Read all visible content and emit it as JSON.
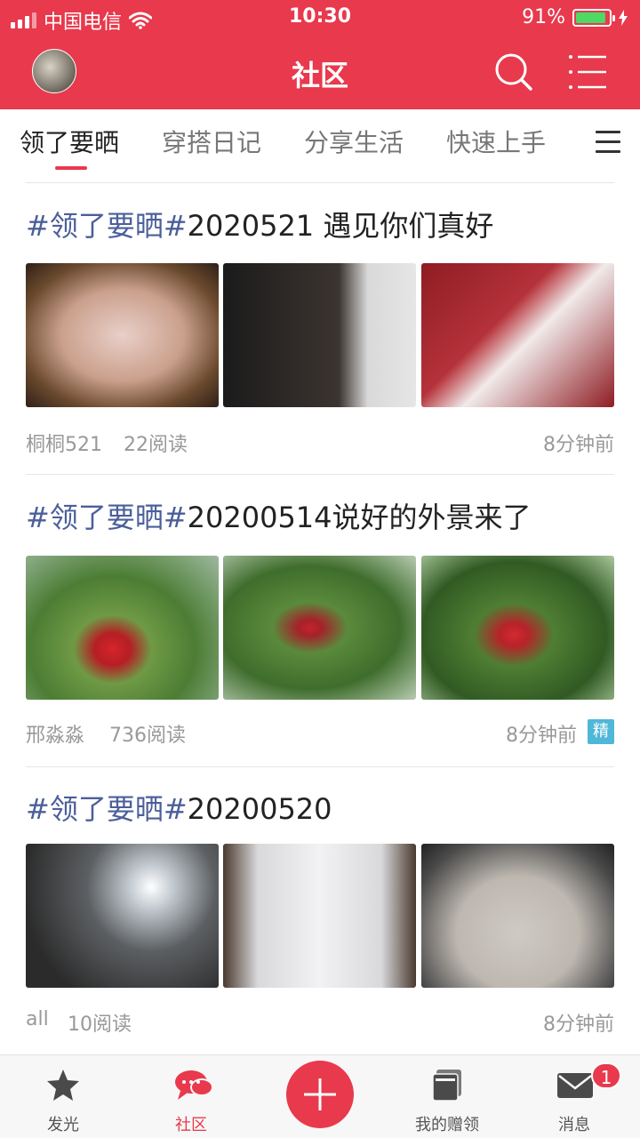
{
  "status_bar": {
    "carrier": "中国电信",
    "time": "10:30",
    "battery": "91%",
    "battery_level": 0.91
  },
  "header": {
    "title": "社区"
  },
  "tabs": [
    {
      "label": "领了要晒",
      "active": true
    },
    {
      "label": "穿搭日记",
      "active": false
    },
    {
      "label": "分享生活",
      "active": false
    },
    {
      "label": "快速上手",
      "active": false
    }
  ],
  "posts": [
    {
      "tag": "#领了要晒#",
      "title": "2020521 遇见你们真好",
      "author": "桐桐521",
      "reads": "22阅读",
      "time": "8分钟前"
    },
    {
      "tag": "#领了要晒#",
      "title": "20200514说好的外景来了",
      "author": "邢淼淼",
      "reads": "736阅读",
      "time": "8分钟前",
      "badge": "精"
    },
    {
      "tag": "#领了要晒#",
      "title": "20200520",
      "author": "all",
      "reads": "10阅读",
      "time": "8分钟前"
    }
  ],
  "bottom_nav": [
    {
      "label": "发光",
      "icon": "star-icon",
      "active": false
    },
    {
      "label": "社区",
      "icon": "chat-bubble-icon",
      "active": true
    },
    {
      "label": "我的赠领",
      "icon": "stack-icon",
      "active": false
    },
    {
      "label": "消息",
      "icon": "envelope-icon",
      "active": false
    }
  ],
  "notification_count": "1",
  "colors": {
    "brand": "#e8394d",
    "tag": "#4b5f9a",
    "badge": "#4fb7d8"
  }
}
